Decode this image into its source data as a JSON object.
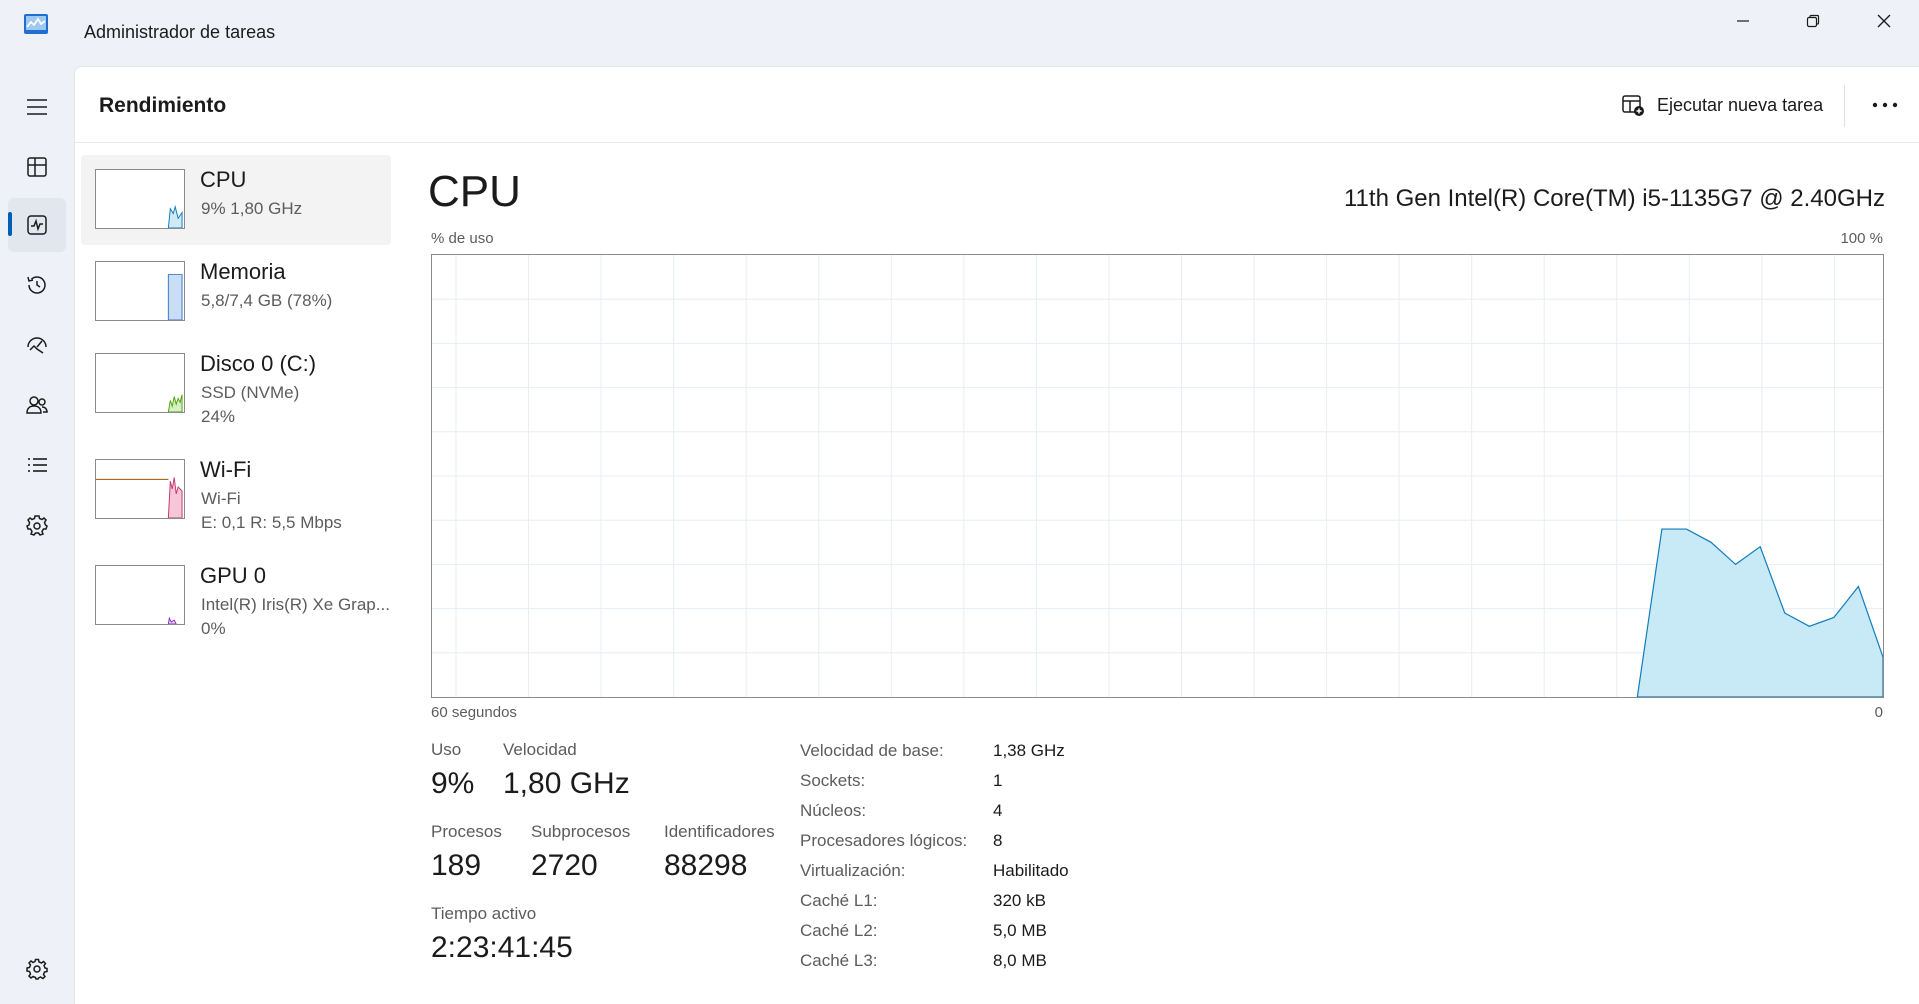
{
  "window": {
    "title": "Administrador de tareas"
  },
  "header": {
    "page_title": "Rendimiento",
    "run_task_label": "Ejecutar nueva tarea"
  },
  "nav": {
    "icons": [
      "hamburger-menu-icon",
      "processes-icon",
      "performance-icon",
      "app-history-icon",
      "startup-apps-icon",
      "users-icon",
      "details-icon",
      "services-icon",
      "settings-icon"
    ],
    "active": "performance-icon"
  },
  "devices": [
    {
      "name": "CPU",
      "sub1": "9%  1,80 GHz",
      "sub2": "",
      "color": "#117dbb",
      "fill": "#cfeaf6",
      "usage": 0.09
    },
    {
      "name": "Memoria",
      "sub1": "5,8/7,4 GB (78%)",
      "sub2": "",
      "color": "#3c78c8",
      "fill": "#c9ddf5",
      "usage": 0.78
    },
    {
      "name": "Disco 0 (C:)",
      "sub1": "SSD (NVMe)",
      "sub2": "24%",
      "color": "#4da60c",
      "fill": "#d8f0c6",
      "usage": 0.24
    },
    {
      "name": "Wi-Fi",
      "sub1": "Wi-Fi",
      "sub2": "E: 0,1  R: 5,5 Mbps",
      "color": "#a74f01",
      "fill": "#f7c6d8",
      "usage": 0.7
    },
    {
      "name": "GPU 0",
      "sub1": "Intel(R) Iris(R) Xe Grap...",
      "sub2": "0%",
      "color": "#8e30c4",
      "fill": "#e7d3f2",
      "usage": 0.0
    }
  ],
  "detail": {
    "title": "CPU",
    "model": "11th Gen Intel(R) Core(TM) i5-1135G7 @ 2.40GHz",
    "y_axis_label": "% de uso",
    "y_axis_max": "100 %",
    "x_axis_label": "60 segundos",
    "x_axis_min": "0",
    "stats": {
      "uso_label": "Uso",
      "uso_value": "9%",
      "velocidad_label": "Velocidad",
      "velocidad_value": "1,80 GHz",
      "procesos_label": "Procesos",
      "procesos_value": "189",
      "subprocesos_label": "Subprocesos",
      "subprocesos_value": "2720",
      "identificadores_label": "Identificadores",
      "identificadores_value": "88298",
      "tiempo_label": "Tiempo activo",
      "tiempo_value": "2:23:41:45"
    },
    "specs": [
      {
        "k": "Velocidad de base:",
        "v": "1,38 GHz"
      },
      {
        "k": "Sockets:",
        "v": "1"
      },
      {
        "k": "Núcleos:",
        "v": "4"
      },
      {
        "k": "Procesadores lógicos:",
        "v": "8"
      },
      {
        "k": "Virtualización:",
        "v": "Habilitado"
      },
      {
        "k": "Caché L1:",
        "v": "320 kB"
      },
      {
        "k": "Caché L2:",
        "v": "5,0 MB"
      },
      {
        "k": "Caché L3:",
        "v": "8,0 MB"
      }
    ]
  },
  "chart_data": {
    "type": "area",
    "y_range": [
      0,
      100
    ],
    "x_range": [
      60,
      0
    ],
    "series_color": "#117dbb",
    "fill_color": "#c8e9f6",
    "values_tail": [
      0,
      38,
      38,
      35,
      30,
      34,
      19,
      16,
      18,
      25,
      9
    ]
  }
}
